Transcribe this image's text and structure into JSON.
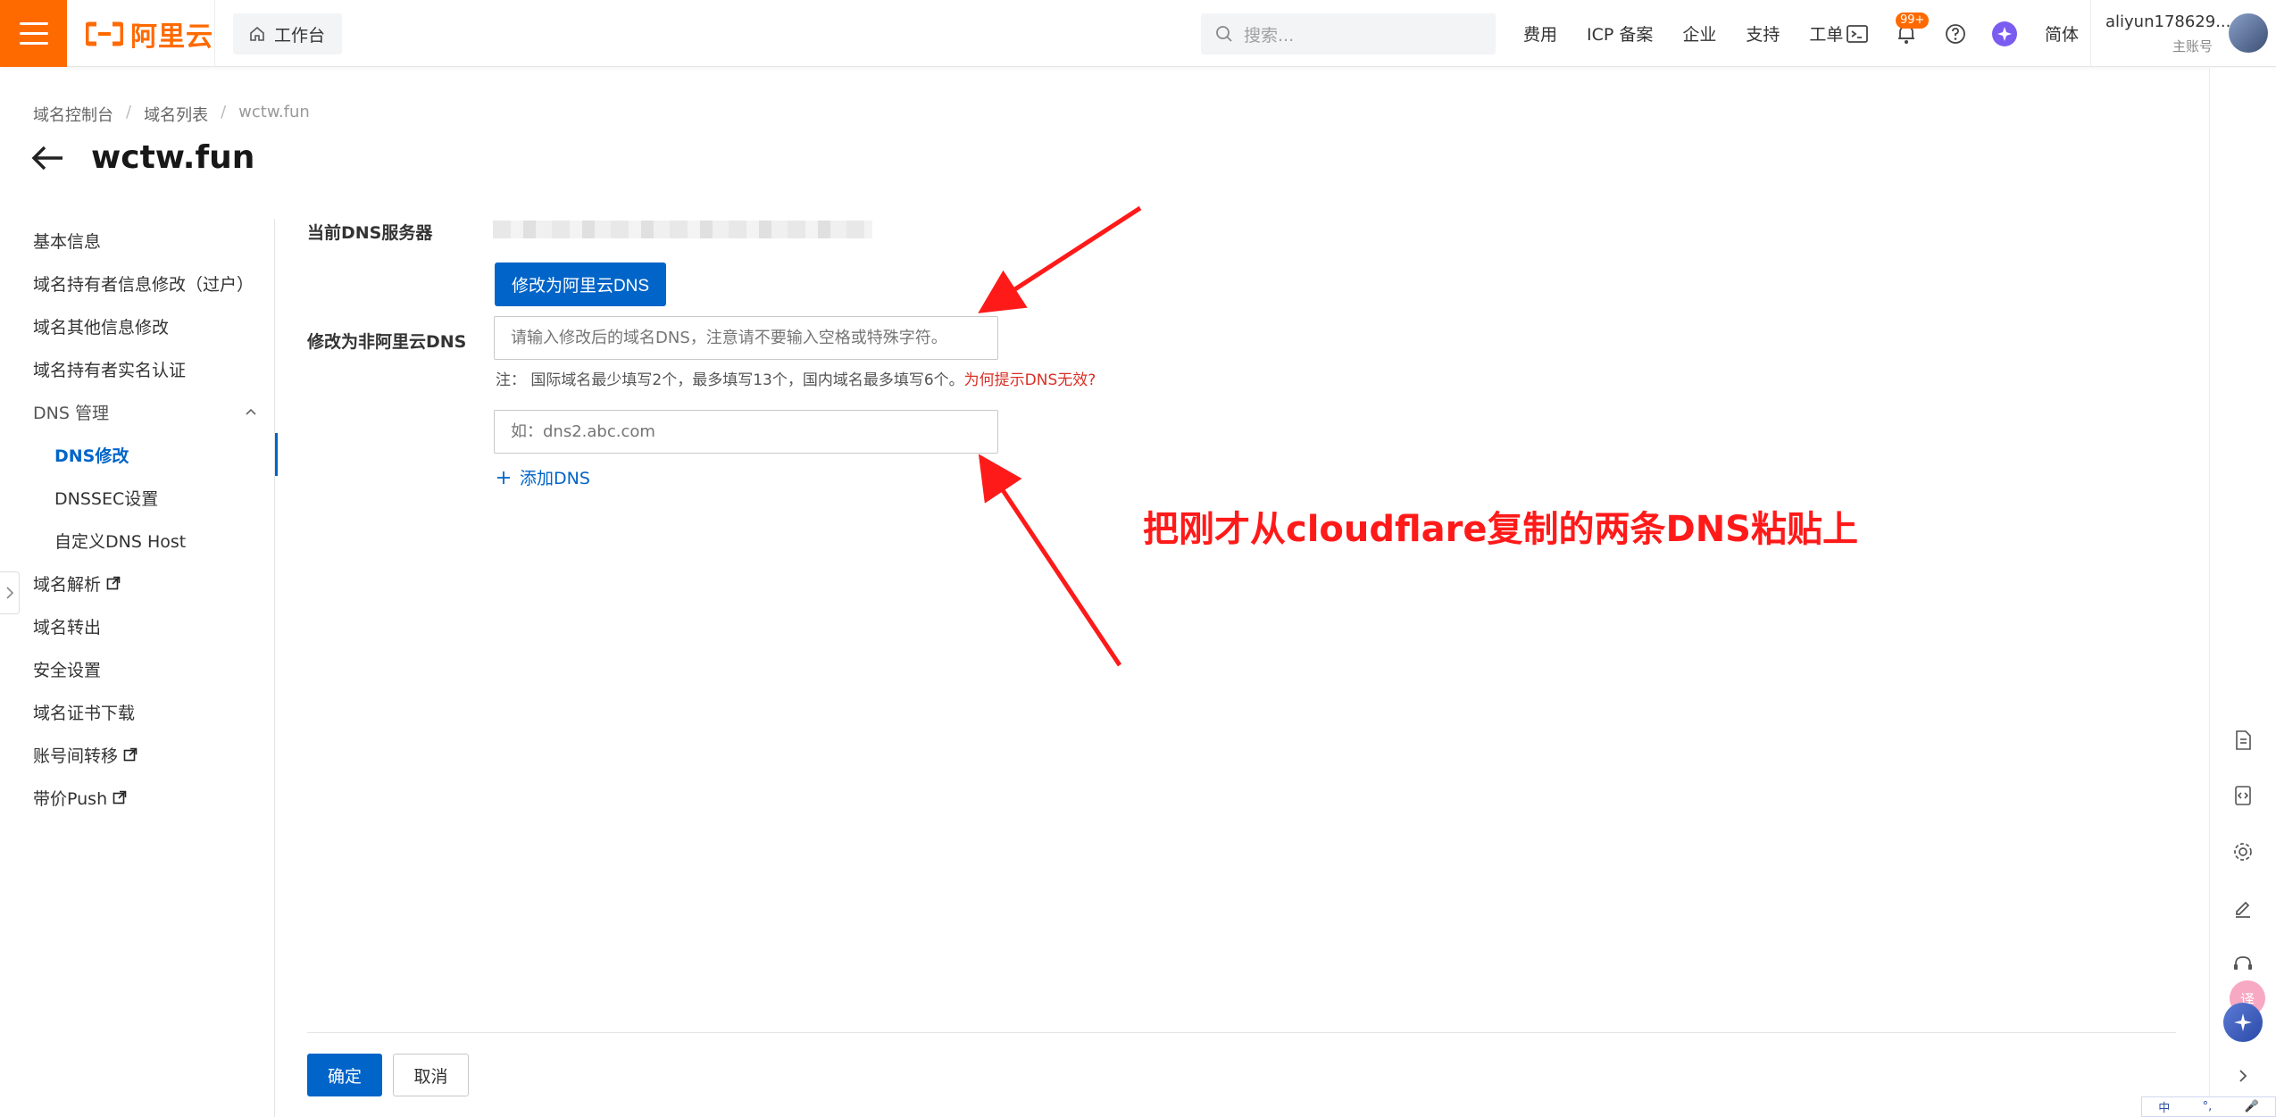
{
  "header": {
    "logo": "阿里云",
    "workbench": "工作台",
    "search_placeholder": "搜索...",
    "nav": [
      "费用",
      "ICP 备案",
      "企业",
      "支持",
      "工单"
    ],
    "notification_badge": "99+",
    "language": "简体",
    "user_name": "aliyun178629...",
    "user_role": "主账号"
  },
  "breadcrumb": [
    "域名控制台",
    "域名列表",
    "wctw.fun"
  ],
  "page_title": "wctw.fun",
  "sidebar": {
    "items": [
      {
        "label": "基本信息"
      },
      {
        "label": "域名持有者信息修改（过户）"
      },
      {
        "label": "域名其他信息修改"
      },
      {
        "label": "域名持有者实名认证"
      },
      {
        "label": "DNS 管理"
      },
      {
        "label": "DNS修改"
      },
      {
        "label": "DNSSEC设置"
      },
      {
        "label": "自定义DNS Host"
      },
      {
        "label": "域名解析"
      },
      {
        "label": "域名转出"
      },
      {
        "label": "安全设置"
      },
      {
        "label": "域名证书下载"
      },
      {
        "label": "账号间转移"
      },
      {
        "label": "带价Push"
      }
    ]
  },
  "form": {
    "current_dns_label": "当前DNS服务器",
    "switch_to_aliyun_button": "修改为阿里云DNS",
    "non_aliyun_label": "修改为非阿里云DNS",
    "dns1_placeholder": "请输入修改后的域名DNS，注意请不要输入空格或特殊字符。",
    "note": "注：  国际域名最少填写2个，最多填写13个，国内域名最多填写6个。",
    "note_link": "为何提示DNS无效?",
    "dns2_placeholder": "如：dns2.abc.com",
    "add_dns": "添加DNS",
    "confirm": "确定",
    "cancel": "取消"
  },
  "annotation": {
    "text": "把刚才从cloudflare复制的两条DNS粘贴上",
    "color": "#ff1a1a"
  },
  "ime": {
    "items": [
      "中",
      "°,",
      "🎤"
    ]
  },
  "colors": {
    "brand": "#ff6a00",
    "primary": "#0064c8",
    "warn": "#d93026"
  }
}
